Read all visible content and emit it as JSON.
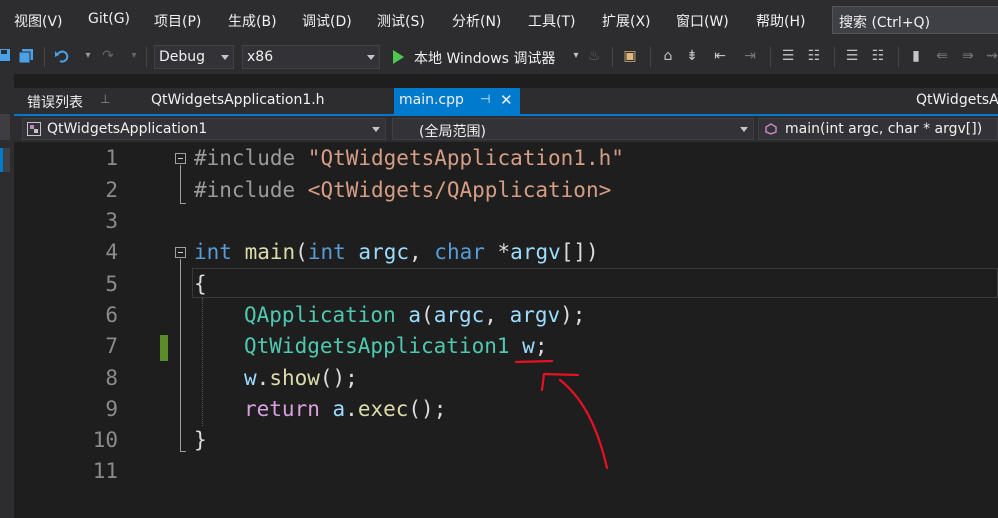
{
  "menu": {
    "items": [
      "视图(V)",
      "Git(G)",
      "项目(P)",
      "生成(B)",
      "调试(D)",
      "测试(S)",
      "分析(N)",
      "工具(T)",
      "扩展(X)",
      "窗口(W)",
      "帮助(H)"
    ],
    "search_label": "搜索 (Ctrl+Q)"
  },
  "toolbar": {
    "configuration": "Debug",
    "platform": "x86",
    "run_label": "本地 Windows 调试器"
  },
  "tabs": {
    "error_list": "错误列表",
    "header_file": "QtWidgetsApplication1.h",
    "active_file": "main.cpp",
    "right_tab": "QtWidgetsA"
  },
  "navbar": {
    "project": "QtWidgetsApplication1",
    "scope": "(全局范围)",
    "member": "main(int argc, char * argv[])"
  },
  "editor": {
    "line_numbers": [
      "1",
      "2",
      "3",
      "4",
      "5",
      "6",
      "7",
      "8",
      "9",
      "10",
      "11"
    ],
    "lines": {
      "l1_directive": "#include",
      "l1_file": "\"QtWidgetsApplication1.h\"",
      "l2_directive": "#include",
      "l2_file": "<QtWidgets/QApplication>",
      "l4_int": "int",
      "l4_main": "main",
      "l4_int2": "int",
      "l4_argc": "argc",
      "l4_char": "char",
      "l4_argv": "argv",
      "l5_brace": "{",
      "l6_type": "QApplication",
      "l6_a": "a",
      "l6_argc": "argc",
      "l6_argv": "argv",
      "l7_type": "QtWidgetsApplication1",
      "l7_w": "w",
      "l8_w": "w",
      "l8_show": "show",
      "l9_return": "return",
      "l9_a": "a",
      "l9_exec": "exec",
      "l10_brace": "}"
    }
  },
  "colors": {
    "accent": "#007acc",
    "annotation": "#e81123",
    "change_bar": "#5b8c2a"
  }
}
